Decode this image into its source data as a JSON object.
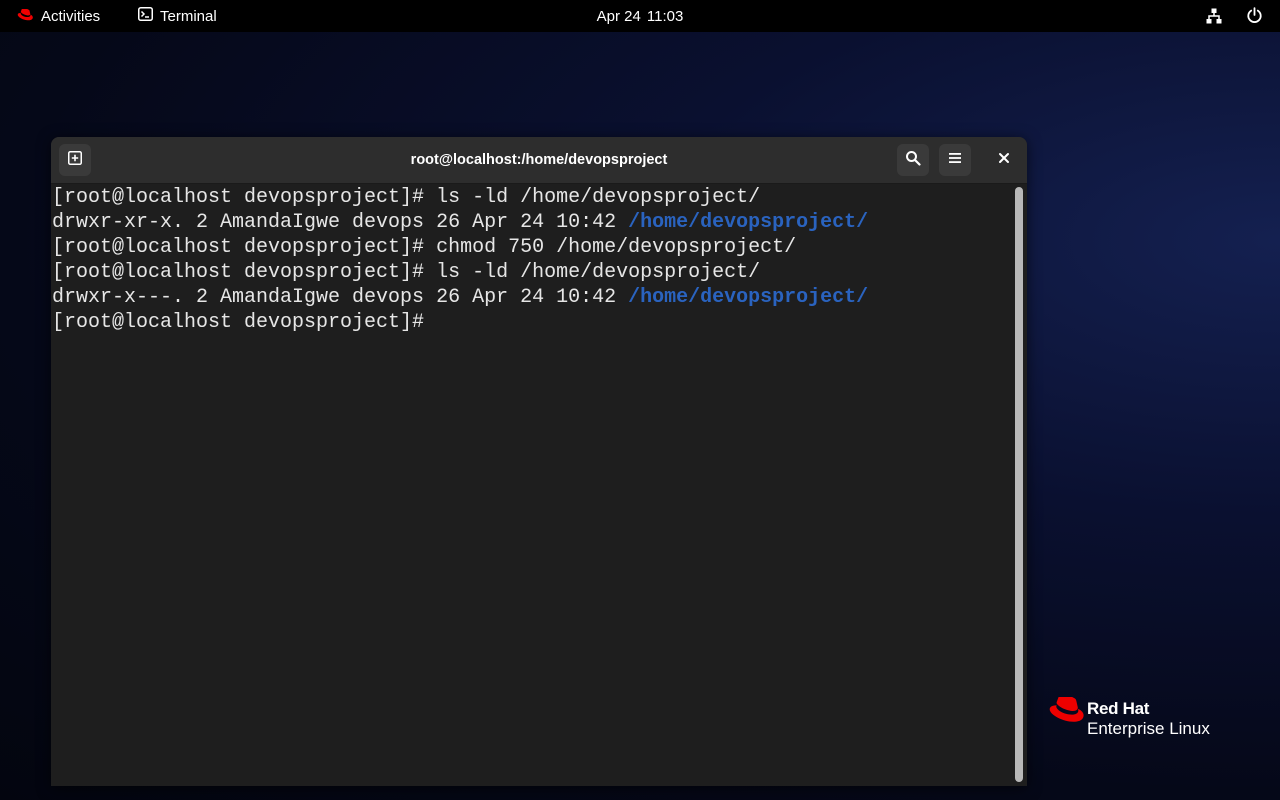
{
  "topbar": {
    "activities_label": "Activities",
    "app_name": "Terminal",
    "date": "Apr 24",
    "time": "11:03"
  },
  "window": {
    "title": "root@localhost:/home/devopsproject"
  },
  "terminal": {
    "lines": [
      {
        "text": "[root@localhost devopsproject]# ls -ld /home/devopsproject/",
        "dir": ""
      },
      {
        "text": "drwxr-xr-x. 2 AmandaIgwe devops 26 Apr 24 10:42 ",
        "dir": "/home/devopsproject/"
      },
      {
        "text": "[root@localhost devopsproject]# chmod 750 /home/devopsproject/",
        "dir": ""
      },
      {
        "text": "[root@localhost devopsproject]# ls -ld /home/devopsproject/",
        "dir": ""
      },
      {
        "text": "drwxr-x---. 2 AmandaIgwe devops 26 Apr 24 10:42 ",
        "dir": "/home/devopsproject/"
      },
      {
        "text": "[root@localhost devopsproject]# ",
        "dir": ""
      }
    ]
  },
  "branding": {
    "brand": "Red Hat",
    "product": "Enterprise Linux"
  },
  "icons": {
    "activities": "redhat-hat-icon",
    "app": "terminal-icon",
    "network": "network-icon",
    "power": "power-icon",
    "new_tab": "new-tab-icon",
    "search": "search-icon",
    "menu": "hamburger-menu-icon",
    "close": "close-icon"
  },
  "colors": {
    "accent_red": "#ee0000",
    "directory_blue": "#2a63bf",
    "terminal_bg": "#1e1e1e",
    "headerbar_bg": "#2d2d2d"
  }
}
